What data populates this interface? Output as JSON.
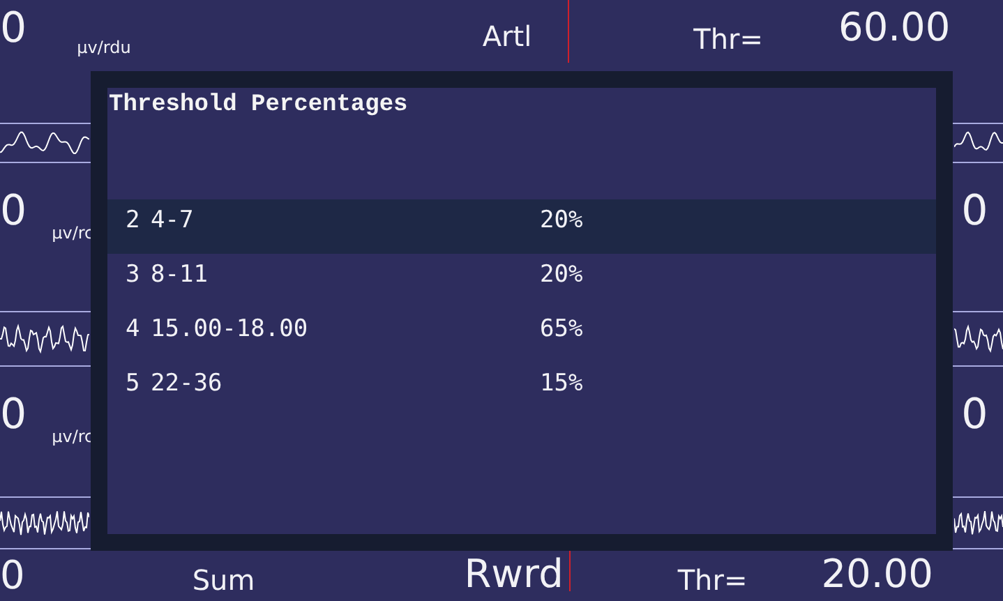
{
  "background": {
    "top_panel": {
      "value": "0",
      "unit": "µv/rdu",
      "label": "Artl",
      "threshold_label": "Thr=",
      "threshold_value": "60.00"
    },
    "channels": [
      {
        "value": "0",
        "unit": "µv/rc",
        "right_value": "0"
      },
      {
        "value": "0",
        "unit": "µv/rc",
        "right_value": "0"
      }
    ],
    "bottom_panel": {
      "value": "0",
      "label": "Sum",
      "reward_label": "Rwrd",
      "threshold_label": "Thr=",
      "threshold_value": "20.00"
    }
  },
  "dialog": {
    "title": "Threshold Percentages",
    "rows": [
      {
        "index": "2",
        "range": "4-7",
        "percent": "20%",
        "selected": true
      },
      {
        "index": "3",
        "range": "8-11",
        "percent": "20%",
        "selected": false
      },
      {
        "index": "4",
        "range": "15.00-18.00",
        "percent": "65%",
        "selected": false
      },
      {
        "index": "5",
        "range": "22-36",
        "percent": "15%",
        "selected": false
      }
    ]
  }
}
